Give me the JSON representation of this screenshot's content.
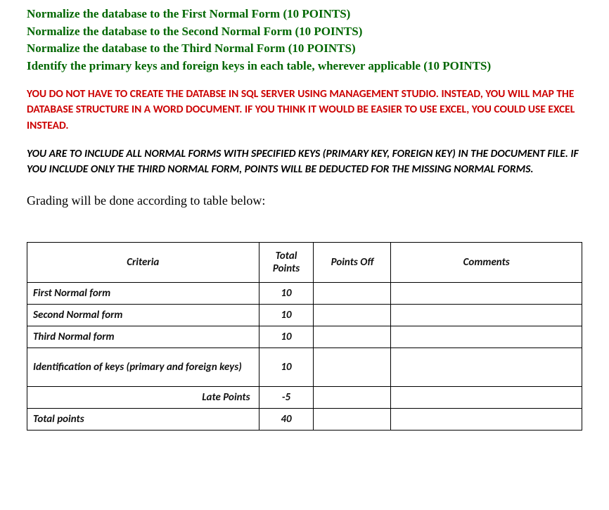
{
  "bullets": {
    "b1": "Normalize the database to the First Normal Form (10 POINTS)",
    "b2": "Normalize the database to the Second Normal Form (10 POINTS)",
    "b3": "Normalize the database to the Third Normal Form (10 POINTS)",
    "b4": "Identify the primary keys and foreign keys in each table, wherever applicable (10 POINTS)"
  },
  "red_note": "YOU DO NOT HAVE TO CREATE THE DATABSE IN SQL SERVER USING MANAGEMENT STUDIO. INSTEAD, YOU WILL MAP THE DATABASE STRUCTURE IN A WORD DOCUMENT. IF YOU THINK IT WOULD BE EASIER TO USE EXCEL, YOU COULD USE EXCEL INSTEAD.",
  "black_note": "YOU ARE TO INCLUDE ALL NORMAL FORMS WITH SPECIFIED KEYS (PRIMARY KEY, FOREIGN KEY) IN THE DOCUMENT FILE. IF YOU INCLUDE ONLY THE THIRD NORMAL FORM, POINTS WILL BE DEDUCTED FOR THE MISSING NORMAL FORMS.",
  "grading_line": "Grading will be done according to table below:",
  "table": {
    "headers": {
      "criteria": "Criteria",
      "total_points": "Total Points",
      "points_off": "Points Off",
      "comments": "Comments"
    },
    "rows": {
      "r1": {
        "criteria": "First Normal form",
        "tp": "10",
        "po": "",
        "cm": ""
      },
      "r2": {
        "criteria": "Second Normal form",
        "tp": "10",
        "po": "",
        "cm": ""
      },
      "r3": {
        "criteria": "Third Normal form",
        "tp": "10",
        "po": "",
        "cm": ""
      },
      "r4": {
        "criteria": "Identification of keys (primary and foreign keys)",
        "tp": "10",
        "po": "",
        "cm": ""
      },
      "r5": {
        "criteria": "Late Points",
        "tp": "-5",
        "po": "",
        "cm": ""
      },
      "r6": {
        "criteria": "Total points",
        "tp": "40",
        "po": "",
        "cm": ""
      }
    }
  }
}
